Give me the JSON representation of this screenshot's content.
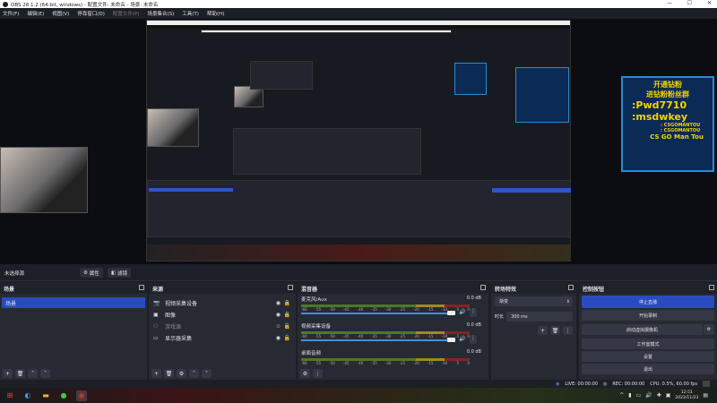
{
  "window": {
    "title": "OBS 28.1.2 (64-bit, windows) - 配置文件: 未命名 - 场景: 未命名",
    "minimize": "—",
    "maximize": "☐",
    "close": "✕"
  },
  "menu": [
    {
      "label": "文件(F)"
    },
    {
      "label": "编辑(E)"
    },
    {
      "label": "视图(V)"
    },
    {
      "label": "停靠窗口(D)"
    },
    {
      "label": "配置文件(P)",
      "disabled": true
    },
    {
      "label": "场景集合(S)"
    },
    {
      "label": "工具(T)"
    },
    {
      "label": "帮助(H)"
    }
  ],
  "overlay_card": {
    "line1": "开通钻粉",
    "line2": "进钻粉粉丝群",
    "pwd": ":Pwd7710",
    "wechat": ":msdwkey",
    "wx2": ": CSGOMANTOU",
    "tiktok": ": CSGOMANTOU",
    "sign": "CS GO Man Tou"
  },
  "source_toolbar": {
    "status": "未选择源",
    "properties": "属性",
    "filters": "滤镜"
  },
  "scenes": {
    "title": "场景",
    "items": [
      "场景"
    ]
  },
  "sources": {
    "title": "来源",
    "items": [
      {
        "label": "视频采集设备",
        "icon": "camera-icon",
        "visible": true
      },
      {
        "label": "图像",
        "icon": "image-icon",
        "visible": true
      },
      {
        "label": "游戏源",
        "icon": "gamepad-icon",
        "visible": false
      },
      {
        "label": "显示器采集",
        "icon": "monitor-icon",
        "visible": true
      }
    ]
  },
  "mixer": {
    "title": "混音器",
    "ticks": [
      "-60",
      "-55",
      "-50",
      "-45",
      "-40",
      "-35",
      "-30",
      "-25",
      "-20",
      "-15",
      "-10",
      "-5",
      "0"
    ],
    "channels": [
      {
        "name": "麦克风/Aux",
        "db": "0.0 dB",
        "level": 0.95
      },
      {
        "name": "视频采集设备",
        "db": "0.0 dB",
        "level": 0.95
      },
      {
        "name": "桌面音频",
        "db": "0.0 dB"
      }
    ]
  },
  "transitions": {
    "title": "转场特效",
    "selected": "渐变",
    "duration_label": "时长",
    "duration": "300 ms"
  },
  "controls": {
    "title": "控制按钮",
    "stop_stream": "停止直播",
    "start_record": "开始录制",
    "virtual_cam": "启动虚拟摄像机",
    "studio_mode": "工作室模式",
    "settings": "设置",
    "exit": "退出"
  },
  "status": {
    "live": "LIVE: 00:00:00",
    "rec": "REC: 00:00:00",
    "cpu": "CPU: 0.5%, 60.00 fps"
  },
  "taskbar": {
    "time": "12:51",
    "date": "2022/11/23"
  }
}
